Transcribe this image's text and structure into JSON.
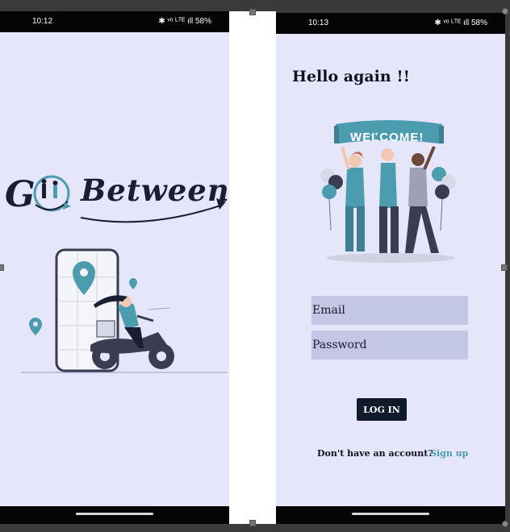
{
  "left_phone": {
    "status_time": "10:12",
    "status_icons": "✱ ᵛᵒ ᴸᵀᴱ ıll 58%",
    "logo_text": "Betweens"
  },
  "right_phone": {
    "status_time": "10:13",
    "status_icons": "✱ ᵛᵒ ᴸᵀᴱ ıll 58%",
    "heading": "Hello again !!",
    "banner_text": "WELCOME!",
    "email_placeholder": "Email",
    "password_placeholder": "Password",
    "login_button": "LOG IN",
    "no_account_text": "Don't have an account?",
    "signup_link": "Sign up"
  },
  "colors": {
    "screen_bg": "#e6e6fb",
    "input_bg": "#c3c6e4",
    "button_bg": "#101a2a",
    "accent_teal": "#4c9cb0",
    "ink": "#1a1e33"
  }
}
